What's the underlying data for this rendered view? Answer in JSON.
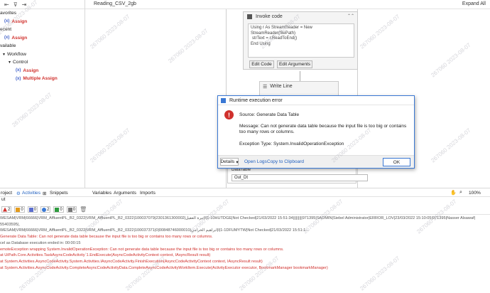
{
  "left_panel": {
    "items": [
      {
        "text": "avorites",
        "kind": "label"
      },
      {
        "text": "Assign",
        "kind": "activity"
      },
      {
        "text": "ecent",
        "kind": "label"
      },
      {
        "text": "Assign",
        "kind": "activity"
      },
      {
        "text": "vailable",
        "kind": "label"
      },
      {
        "text": "Workflow",
        "kind": "group"
      },
      {
        "text": "Control",
        "kind": "group"
      },
      {
        "text": "Assign",
        "kind": "activity"
      },
      {
        "text": "Multiple Assign",
        "kind": "activity"
      }
    ]
  },
  "doc_tabs": {
    "title": "Reading_CSV_2gb",
    "expand_all": "Expand All"
  },
  "invoke_code": {
    "title": "Invoke code",
    "code_lines": [
      "Using r As StreamReader = New StreamReader(filePath)",
      "strText = r.ReadToEnd()",
      "End Using"
    ],
    "edit_code": "Edit Code",
    "edit_arguments": "Edit Arguments"
  },
  "write_line": {
    "title": "Write Line"
  },
  "datatable": {
    "label": "DataTable",
    "value": "Out_Dt"
  },
  "dialog": {
    "title": "Runtime execution error",
    "source": "Source: Generate Data Table",
    "message": "Message: Can not generate data table because the input file is too big or contains too many rows or columns.",
    "exception": "Exception Type: System.InvalidOperationException",
    "details": "Details",
    "open_logs": "Open Logs",
    "copy": "Copy to Clipboard",
    "ok": "OK"
  },
  "bottom_tabs": {
    "left": [
      "roject",
      "Activities",
      "Snippets"
    ],
    "right": [
      "Variables",
      "Arguments",
      "Imports"
    ],
    "zoom": "100%"
  },
  "output": {
    "title": "ut",
    "filters": [
      {
        "count": "2",
        "color": "#d0312d"
      },
      {
        "count": "0",
        "color": "#e39b1c"
      },
      {
        "count": "0",
        "color": "#5b6fcf"
      },
      {
        "count": "2",
        "color": "#3a78d4"
      },
      {
        "count": "0",
        "color": "#2e9b3e"
      },
      {
        "count": "0",
        "color": "#777777"
      }
    ],
    "lines": [
      {
        "text": "WESAM|VRM|66666|VRM_AffluentPL_B2_0322|VRM_AffluentPL_B2_0322|100037079|2301361300002|تيرة العقيل|I|1-10HUTDGE|Not Checked|21/03/2022 15:51:34|||||||||971395|SADMIN|Siebel Administrator|ERROR_LOV|23/03/2022 15:10:05|971395|Nasser Alsawaf|",
        "kind": "gray"
      },
      {
        "text": "55403595|,",
        "kind": "gray"
      },
      {
        "text": "WESAM|VRM|66666|VRM_AffluentPL_B2_0322|VRM_AffluentPL_B2_0322|100037371|0|00848746000010|ابراهيم الخرامي|I|1-1DFUMYTW|Not Checked|21/03/2022 15:51:1...",
        "kind": "gray"
      },
      {
        "text": "Generate Data Table: Can not generate data table because the input file is too big or contains too many rows or columns.",
        "kind": "err"
      },
      {
        "text": "cel as Database execution ended in: 00:00:15",
        "kind": "gray"
      },
      {
        "text": "emoteException wrapping System.InvalidOperationException: Can not generate data table because the input file is too big or contains too many rows or columns.",
        "kind": "err"
      },
      {
        "text": "at UiPath.Core.Activities.TaskAsyncCodeActivity`1.EndExecute(AsyncCodeActivityContext context, IAsyncResult result)",
        "kind": "err"
      },
      {
        "text": "at System.Activities.AsyncCodeActivity.System.Activities.IAsyncCodeActivity.FinishExecution(AsyncCodeActivityContext context, IAsyncResult result)",
        "kind": "err"
      },
      {
        "text": "at System.Activities.AsyncCodeActivity.CompleteAsyncCodeActivityData.CompleteAsyncCodeActivityWorkItem.Execute(ActivityExecutor executor, BookmarkManager bookmarkManager)",
        "kind": "err"
      }
    ]
  },
  "watermark": "267060 2023-08-07",
  "colors": {
    "accent": "#3a78d4",
    "error": "#d0312d"
  }
}
